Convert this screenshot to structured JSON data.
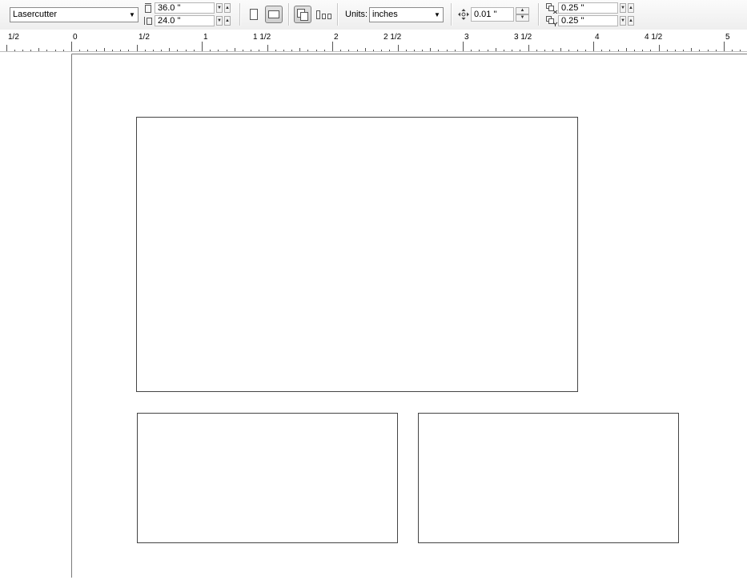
{
  "toolbar": {
    "preset": {
      "value": "Lasercutter"
    },
    "page_width": {
      "value": "36.0 \""
    },
    "page_height": {
      "value": "24.0 \""
    },
    "units": {
      "label": "Units:",
      "value": "inches"
    },
    "nudge": {
      "value": "0.01 \""
    },
    "duplicate_x": {
      "value": "0.25 \""
    },
    "duplicate_y": {
      "value": "0.25 \""
    }
  },
  "ruler": {
    "labels": [
      "1/2",
      "0",
      "1/2",
      "1",
      "1 1/2",
      "2",
      "2 1/2",
      "3",
      "3 1/2",
      "4",
      "4 1/2",
      "5"
    ]
  }
}
